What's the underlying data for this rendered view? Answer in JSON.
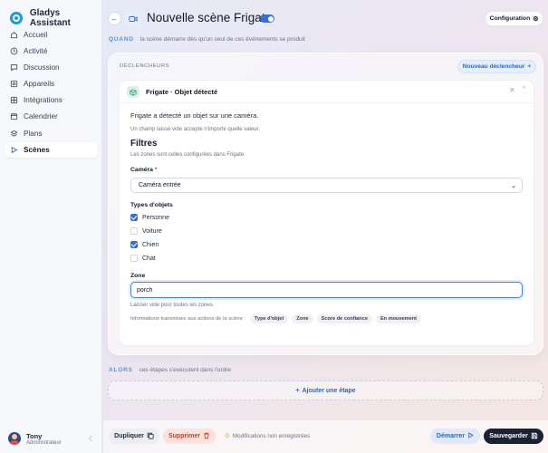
{
  "app": {
    "name": "Gladys Assistant"
  },
  "sidebar": {
    "items": [
      {
        "label": "Accueil",
        "icon": "home-icon"
      },
      {
        "label": "Activité",
        "icon": "clock-icon"
      },
      {
        "label": "Discussion",
        "icon": "chat-icon"
      },
      {
        "label": "Appareils",
        "icon": "devices-icon"
      },
      {
        "label": "Intégrations",
        "icon": "grid-icon"
      },
      {
        "label": "Calendrier",
        "icon": "calendar-icon"
      },
      {
        "label": "Plans",
        "icon": "layers-icon"
      },
      {
        "label": "Scènes",
        "icon": "play-icon",
        "active": true
      }
    ]
  },
  "user": {
    "name": "Tony",
    "role": "Administrateur"
  },
  "header": {
    "title": "Nouvelle scène Frigate",
    "enabled": true,
    "config_label": "Configuration"
  },
  "quand": {
    "keyword": "QUAND",
    "description": "la scène démarre dès qu'un seul de ces événements se produit"
  },
  "triggers": {
    "section_label": "DÉCLENCHEURS",
    "new_label": "Nouveau déclencheur",
    "card": {
      "title": "Frigate · Objet détecté",
      "description": "Frigate a détecté un objet sur une caméra.",
      "hint": "Un champ laissé vide accepte n'importe quelle valeur.",
      "filters_title": "Filtres",
      "filters_subtitle": "Les zones sont celles configurées dans Frigate.",
      "camera_label": "Caméra",
      "camera_required": "*",
      "camera_value": "Caméra entrée",
      "types_label": "Types d'objets",
      "types": [
        {
          "label": "Personne",
          "checked": true
        },
        {
          "label": "Voiture",
          "checked": false
        },
        {
          "label": "Chien",
          "checked": true
        },
        {
          "label": "Chat",
          "checked": false
        }
      ],
      "zone_label": "Zone",
      "zone_value": "porch",
      "zone_hint": "Laisser vide pour toutes les zones.",
      "info_text": "Informations transmises aux actions de la scène :",
      "info_chips": [
        "Type d'objet",
        "Zone",
        "Score de confiance",
        "En mouvement"
      ]
    }
  },
  "alors": {
    "keyword": "ALORS",
    "description": "ces étapes s'exécutent dans l'ordre",
    "add_step_label": "Ajouter une étape"
  },
  "footer": {
    "duplicate_label": "Dupliquer",
    "delete_label": "Supprimer",
    "unsaved_text": "Modifications non enregistrées",
    "start_label": "Démarrer",
    "save_label": "Sauvegarder"
  },
  "colors": {
    "accent": "#3b6ec8",
    "danger": "#c73d2c",
    "dark": "#1b2233",
    "keyword": "#5b8fd8"
  }
}
